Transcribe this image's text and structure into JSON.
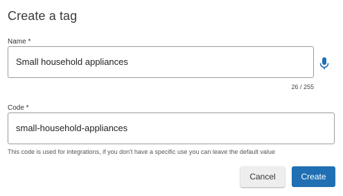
{
  "dialog": {
    "title": "Create a tag",
    "name_field": {
      "label": "Name *",
      "value": "Small household appliances",
      "counter": "26 / 255",
      "mic_icon": "microphone-icon"
    },
    "code_field": {
      "label": "Code *",
      "value": "small-household-appliances",
      "helper": "This code is used for integrations, if you don't have a specific use you can leave the default value"
    },
    "buttons": {
      "cancel": "Cancel",
      "create": "Create"
    },
    "colors": {
      "primary": "#1f6fb2",
      "mic": "#1f6fb2"
    }
  }
}
